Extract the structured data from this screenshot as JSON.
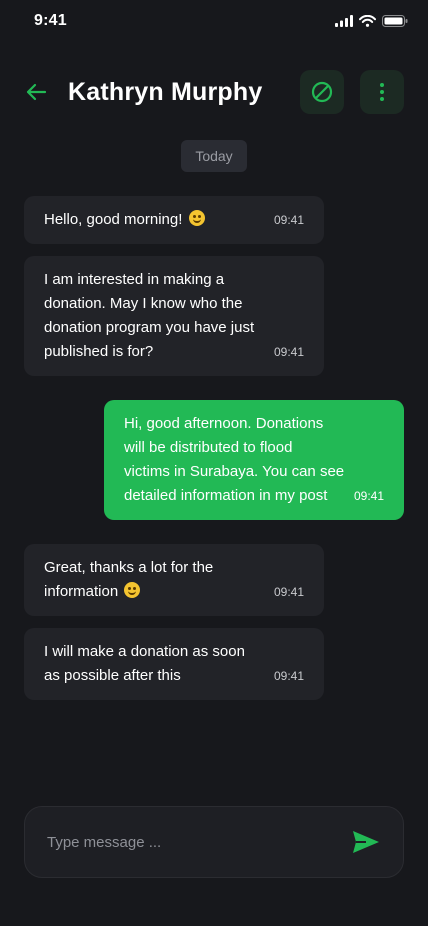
{
  "status_bar": {
    "time": "9:41"
  },
  "header": {
    "contact_name": "Kathryn Murphy"
  },
  "date_divider": "Today",
  "messages": [
    {
      "direction": "incoming",
      "text": "Hello, good morning!",
      "emoji": "smiling-face",
      "time": "09:41"
    },
    {
      "direction": "incoming",
      "lines": [
        "I am interested in making a",
        "donation. May I know who the",
        "donation program you have just",
        "published is for?"
      ],
      "time": "09:41"
    },
    {
      "direction": "outgoing",
      "lines": [
        "Hi, good afternoon. Donations",
        "will be distributed to flood",
        "victims in Surabaya. You can see",
        "detailed information in my post"
      ],
      "time": "09:41"
    },
    {
      "direction": "incoming",
      "lines": [
        "Great, thanks a lot for the",
        "information"
      ],
      "emoji": "grinning-face",
      "time": "09:41"
    },
    {
      "direction": "incoming",
      "lines": [
        "I will make a donation as soon",
        "as possible after this"
      ],
      "time": "09:41"
    }
  ],
  "composer": {
    "placeholder": "Type message ..."
  },
  "colors": {
    "accent": "#22b955",
    "background": "#17181c",
    "bubble_incoming": "#222328"
  }
}
